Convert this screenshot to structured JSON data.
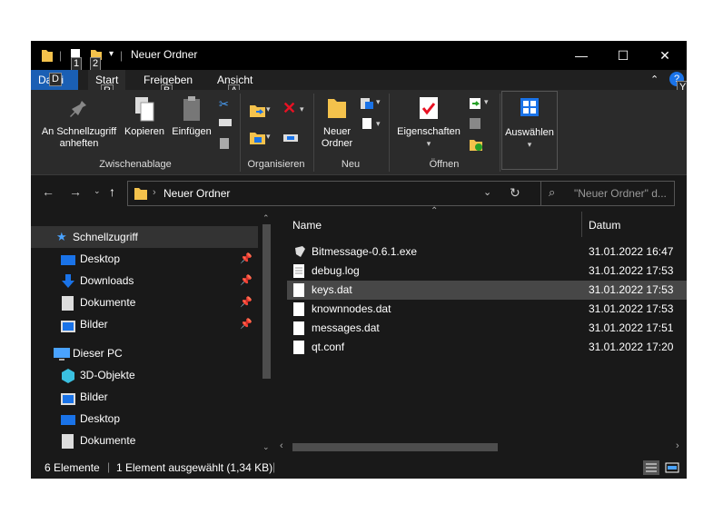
{
  "window": {
    "title": "Neuer Ordner",
    "controls": {
      "minimize": "—",
      "maximize": "☐",
      "close": "✕"
    }
  },
  "qat": {
    "keytips": [
      "1",
      "2"
    ]
  },
  "tabs": [
    {
      "label": "Datei",
      "keytip": "D"
    },
    {
      "label": "Start",
      "keytip": "R"
    },
    {
      "label": "Freigeben",
      "keytip": "B"
    },
    {
      "label": "Ansicht",
      "keytip": "A"
    }
  ],
  "ribbon": {
    "help_keytip": "Y",
    "clipboard": {
      "pin_label": "An Schnellzugriff anheften",
      "copy_label": "Kopieren",
      "paste_label": "Einfügen",
      "group_label": "Zwischenablage"
    },
    "organize": {
      "group_label": "Organisieren"
    },
    "new": {
      "new_folder_label": "Neuer Ordner",
      "group_label": "Neu"
    },
    "open": {
      "properties_label": "Eigenschaften",
      "group_label": "Öffnen"
    },
    "select": {
      "select_label": "Auswählen"
    }
  },
  "address": {
    "path": "Neuer Ordner",
    "search_placeholder": "\"Neuer Ordner\" d..."
  },
  "nav": {
    "quick_access": "Schnellzugriff",
    "items": [
      {
        "label": "Desktop",
        "pinned": true
      },
      {
        "label": "Downloads",
        "pinned": true
      },
      {
        "label": "Dokumente",
        "pinned": true
      },
      {
        "label": "Bilder",
        "pinned": true
      }
    ],
    "this_pc": "Dieser PC",
    "pc_items": [
      {
        "label": "3D-Objekte"
      },
      {
        "label": "Bilder"
      },
      {
        "label": "Desktop"
      },
      {
        "label": "Dokumente"
      }
    ]
  },
  "files": {
    "columns": {
      "name": "Name",
      "date": "Datum"
    },
    "rows": [
      {
        "name": "Bitmessage-0.6.1.exe",
        "date": "31.01.2022 16:47",
        "icon": "app-icon"
      },
      {
        "name": "debug.log",
        "date": "31.01.2022 17:53",
        "icon": "document-icon"
      },
      {
        "name": "keys.dat",
        "date": "31.01.2022 17:53",
        "icon": "document-icon",
        "selected": true
      },
      {
        "name": "knownnodes.dat",
        "date": "31.01.2022 17:53",
        "icon": "document-icon"
      },
      {
        "name": "messages.dat",
        "date": "31.01.2022 17:51",
        "icon": "document-icon"
      },
      {
        "name": "qt.conf",
        "date": "31.01.2022 17:20",
        "icon": "document-icon"
      }
    ]
  },
  "status": {
    "count": "6 Elemente",
    "selection": "1 Element ausgewählt (1,34 KB)"
  },
  "colors": {
    "window_bg": "#191919",
    "ribbon_bg": "#2b2b2b",
    "accent": "#1a5fb4",
    "folder": "#f4c24c",
    "selection": "#474747"
  }
}
